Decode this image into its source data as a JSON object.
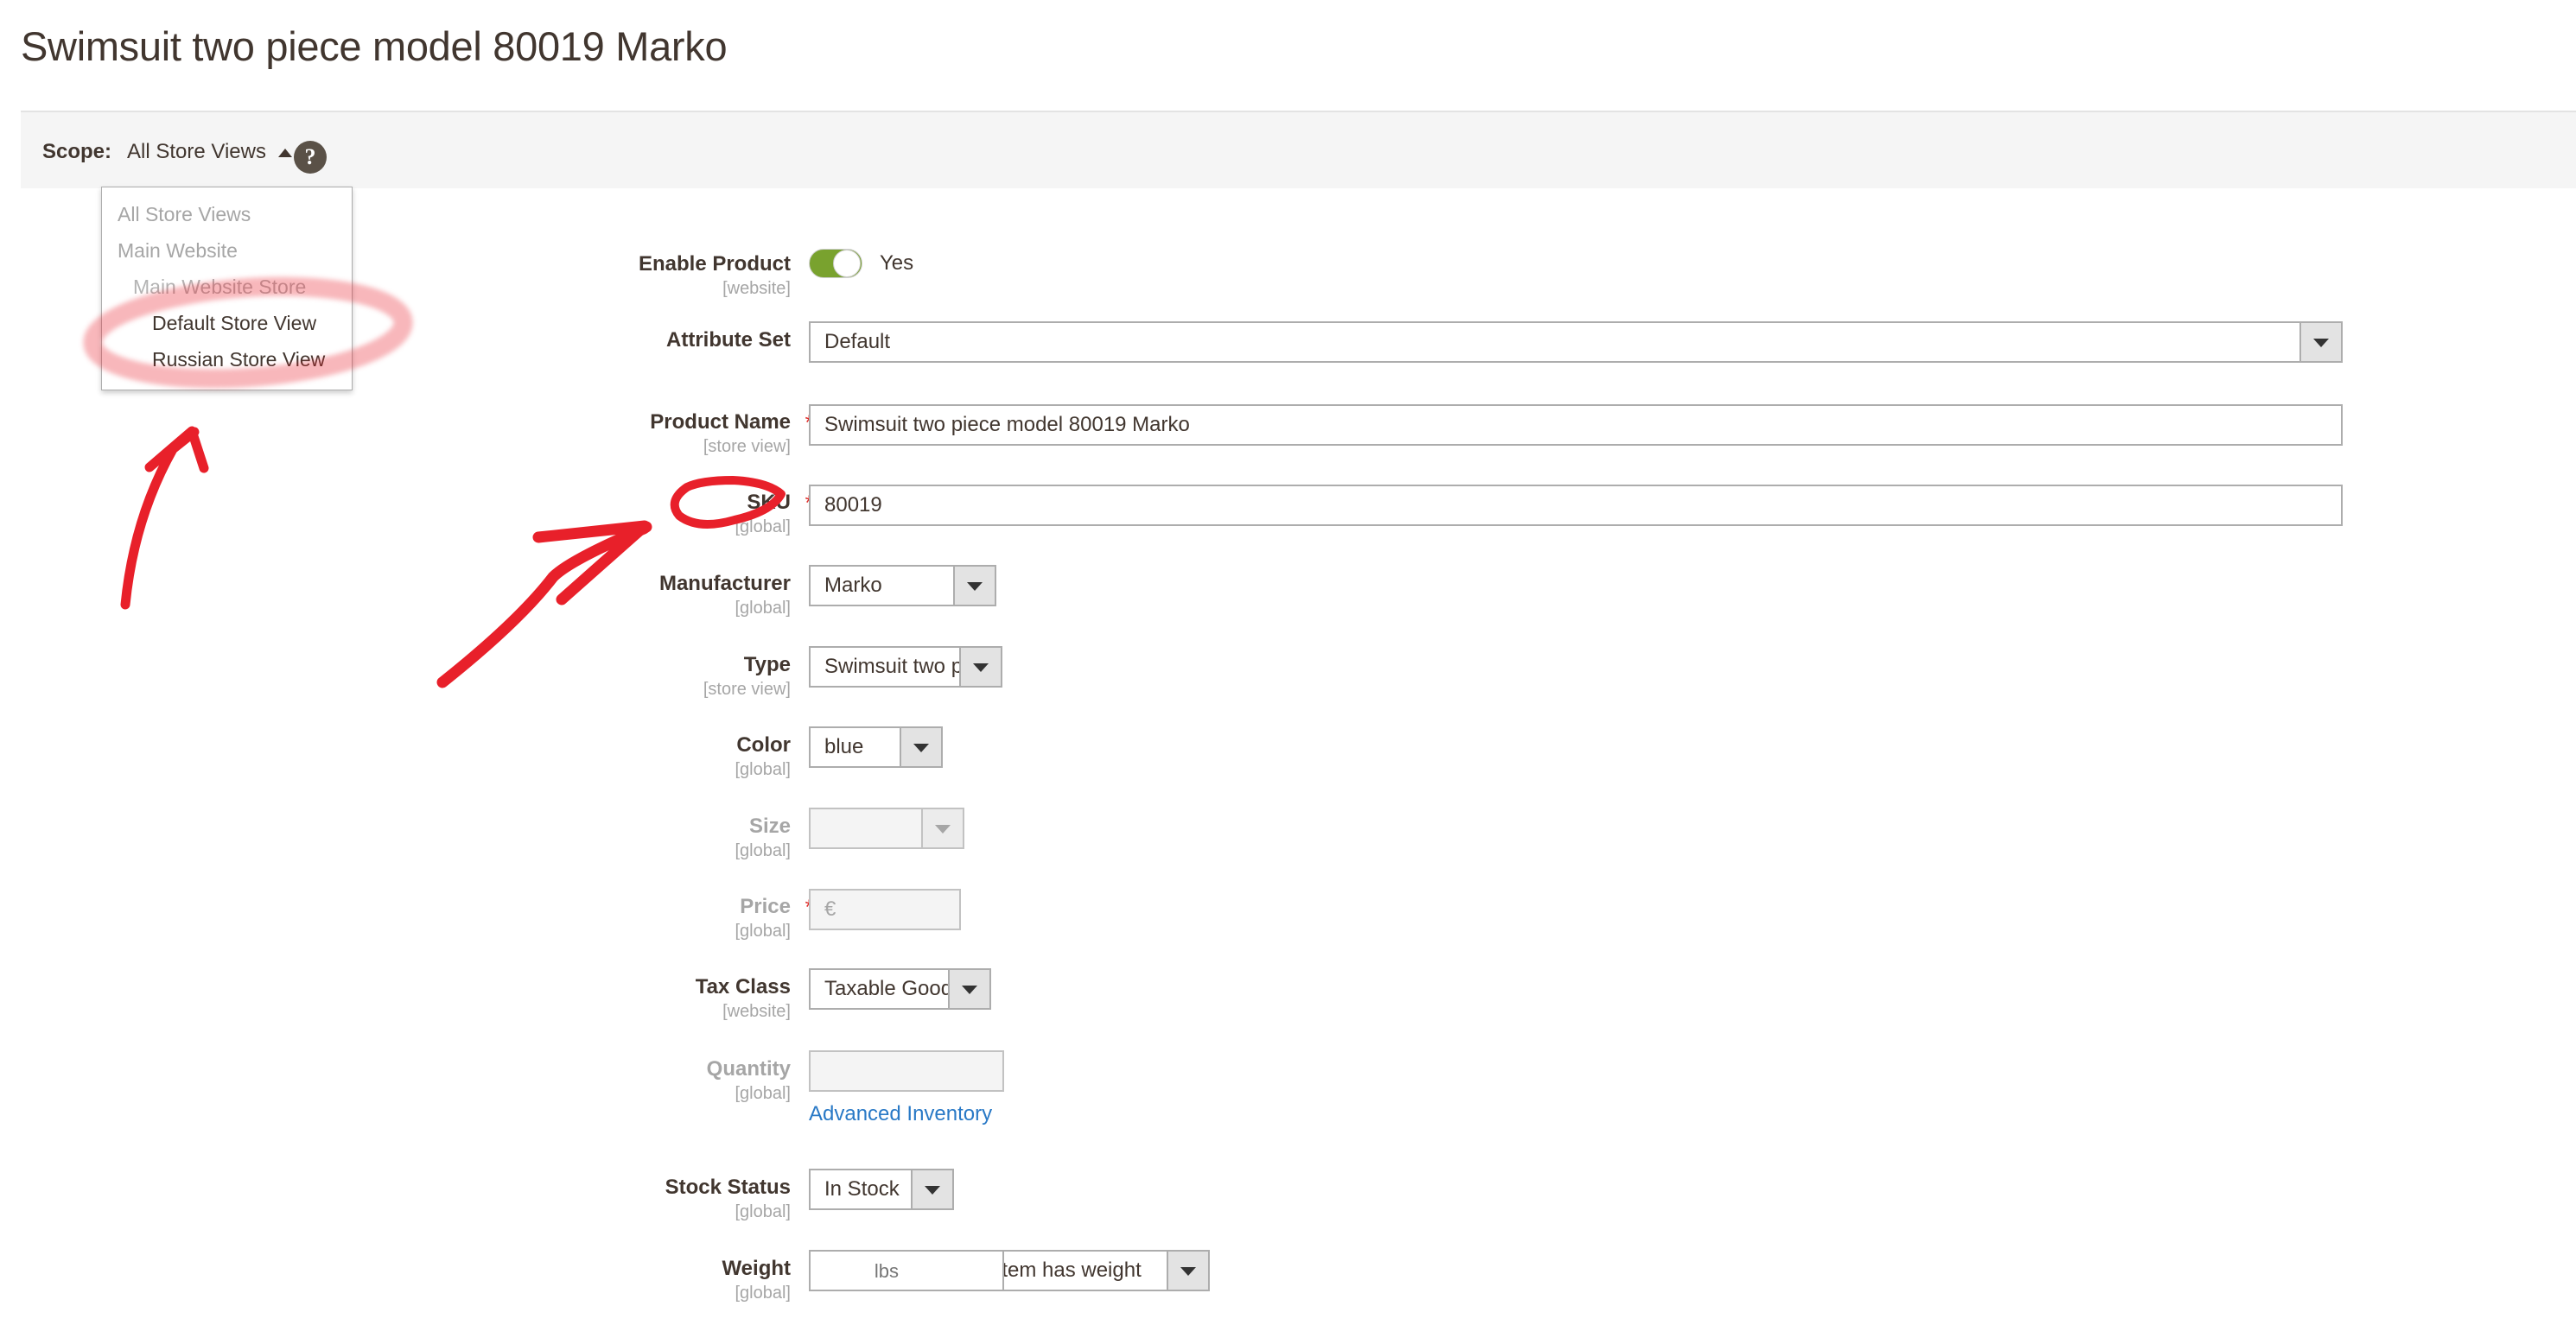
{
  "page": {
    "title": "Swimsuit two piece model 80019 Marko"
  },
  "scope": {
    "label": "Scope:",
    "current": "All Store Views",
    "help_icon_glyph": "?",
    "caret_icon": "caret-up-icon",
    "options": [
      {
        "label": "All Store Views",
        "level": "all"
      },
      {
        "label": "Main Website",
        "level": "website"
      },
      {
        "label": "Main Website Store",
        "level": "store"
      },
      {
        "label": "Default Store View",
        "level": "view"
      },
      {
        "label": "Russian Store View",
        "level": "view"
      }
    ]
  },
  "form": {
    "enable_product": {
      "label": "Enable Product",
      "scope": "[website]",
      "value": "Yes",
      "toggle_on": true
    },
    "attribute_set": {
      "label": "Attribute Set",
      "scope": "",
      "value": "Default"
    },
    "product_name": {
      "label": "Product Name",
      "scope": "[store view]",
      "required": "*",
      "value": "Swimsuit two piece model 80019 Marko"
    },
    "sku": {
      "label": "SKU",
      "scope": "[global]",
      "required": "*",
      "value": "80019"
    },
    "manufacturer": {
      "label": "Manufacturer",
      "scope": "[global]",
      "value": "Marko"
    },
    "type": {
      "label": "Type",
      "scope": "[store view]",
      "value": "Swimsuit two piece"
    },
    "color": {
      "label": "Color",
      "scope": "[global]",
      "value": "blue"
    },
    "size": {
      "label": "Size",
      "scope": "[global]",
      "value": "",
      "disabled": true
    },
    "price": {
      "label": "Price",
      "scope": "[global]",
      "required": "*",
      "value": "€",
      "disabled": true
    },
    "tax_class": {
      "label": "Tax Class",
      "scope": "[website]",
      "value": "Taxable Goods"
    },
    "quantity": {
      "label": "Quantity",
      "scope": "[global]",
      "value": "",
      "disabled": true,
      "link_label": "Advanced Inventory"
    },
    "stock_status": {
      "label": "Stock Status",
      "scope": "[global]",
      "value": "In Stock"
    },
    "weight": {
      "label": "Weight",
      "scope": "[global]",
      "value": "",
      "unit": "lbs",
      "has_weight_value": "This item has weight"
    }
  },
  "annotations": {
    "color": "#e8202a",
    "ellipse_scope_views": "hand-drawn ellipse around Default Store View and Russian Store View",
    "arrow_to_scope": "hand-drawn arrow pointing up at the store view options",
    "ellipse_store_view_tag": "hand-drawn ellipse around [store view]",
    "arrow_to_store_view_tag": "hand-drawn arrow pointing up-right at [store view]"
  }
}
